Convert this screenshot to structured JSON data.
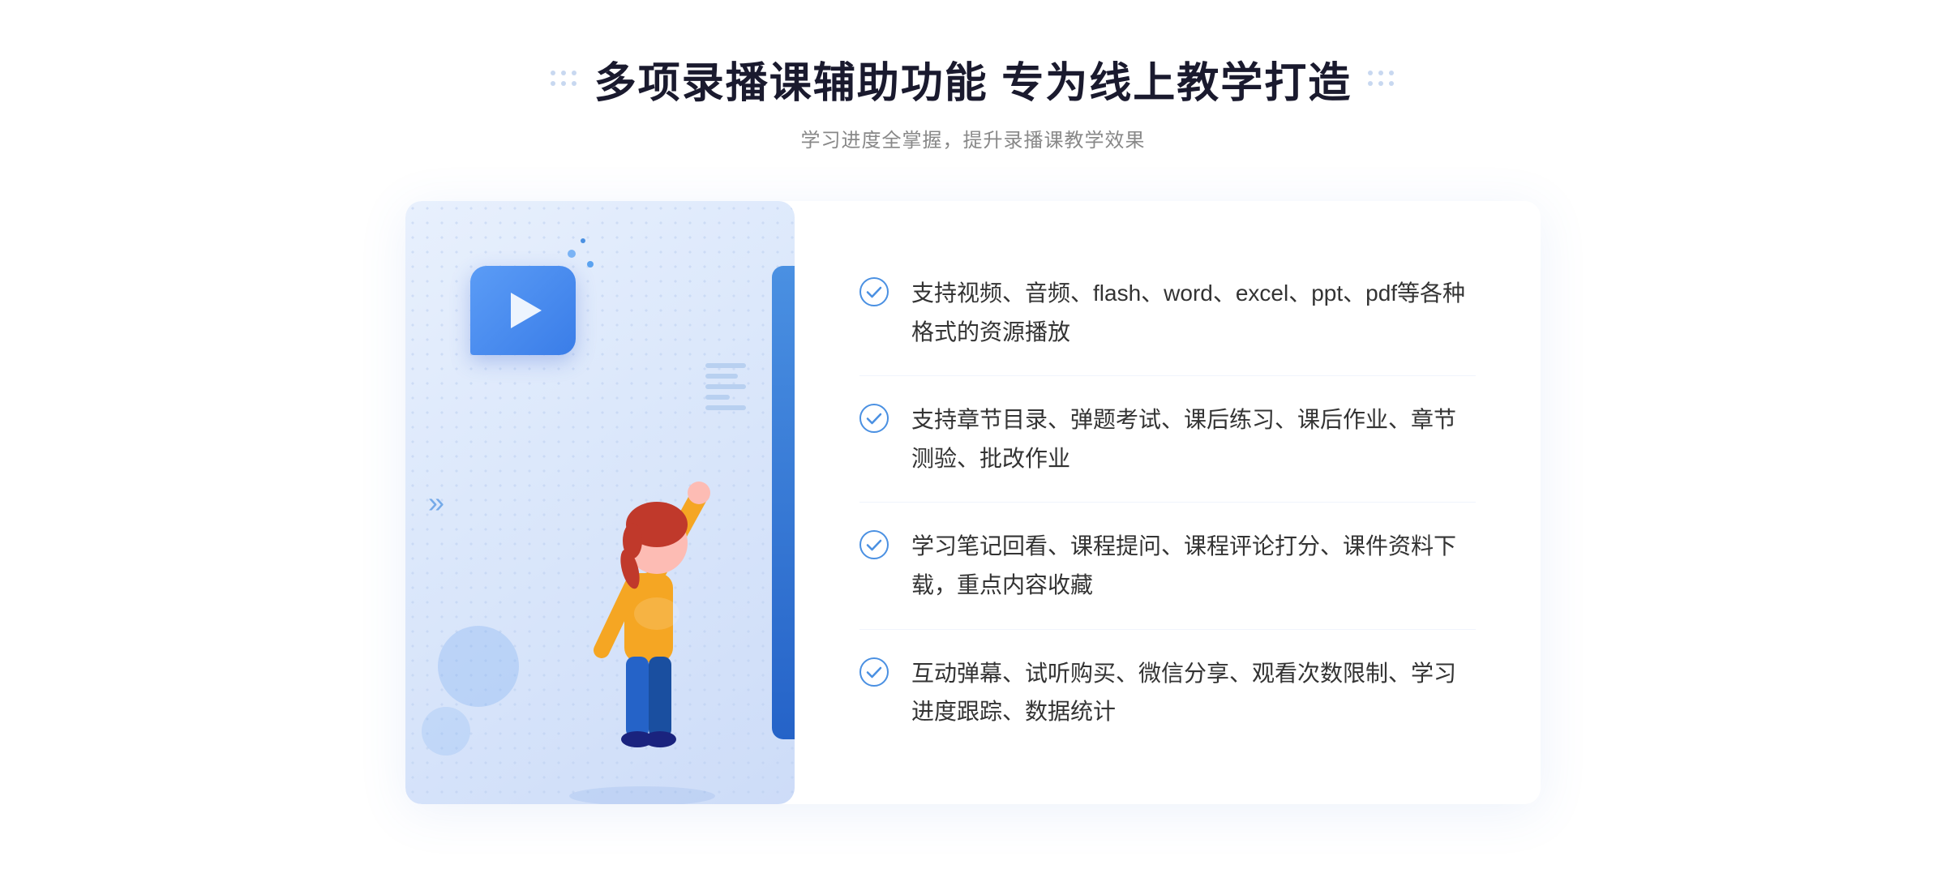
{
  "header": {
    "title": "多项录播课辅助功能 专为线上教学打造",
    "subtitle": "学习进度全掌握，提升录播课教学效果"
  },
  "features": [
    {
      "id": "feature-1",
      "text": "支持视频、音频、flash、word、excel、ppt、pdf等各种格式的资源播放"
    },
    {
      "id": "feature-2",
      "text": "支持章节目录、弹题考试、课后练习、课后作业、章节测验、批改作业"
    },
    {
      "id": "feature-3",
      "text": "学习笔记回看、课程提问、课程评论打分、课件资料下载，重点内容收藏"
    },
    {
      "id": "feature-4",
      "text": "互动弹幕、试听购买、微信分享、观看次数限制、学习进度跟踪、数据统计"
    }
  ],
  "decoration": {
    "chevron": "«",
    "play_label": "play-button"
  }
}
